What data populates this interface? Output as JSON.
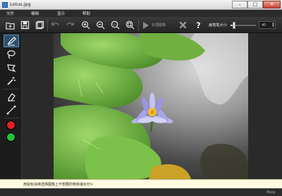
{
  "window": {
    "title": "Lotus.jpg"
  },
  "menu": [
    "文件",
    "编辑",
    "显示",
    "帮助"
  ],
  "toolbar": {
    "buttons": [
      "open",
      "save",
      "save-as",
      "undo",
      "redo",
      "zoom-in",
      "zoom-out",
      "zoom-actual",
      "zoom-fit"
    ],
    "zoom_actual_label": "1:1",
    "process_label": "处理图像",
    "brush_label": "画笔笔大小",
    "brush_size": "40",
    "brush_slider_fraction": 0.15
  },
  "tools": [
    "brush",
    "lasso",
    "polygon-lasso",
    "magic-wand",
    "eraser",
    "line"
  ],
  "colors": {
    "red": "#e02020",
    "green": "#22c03a",
    "accent": "#5f8fbf"
  },
  "hint": "用鼠标涂抹选择图像上不想要的物体或水印>",
  "status": {
    "format": "8bpp"
  }
}
